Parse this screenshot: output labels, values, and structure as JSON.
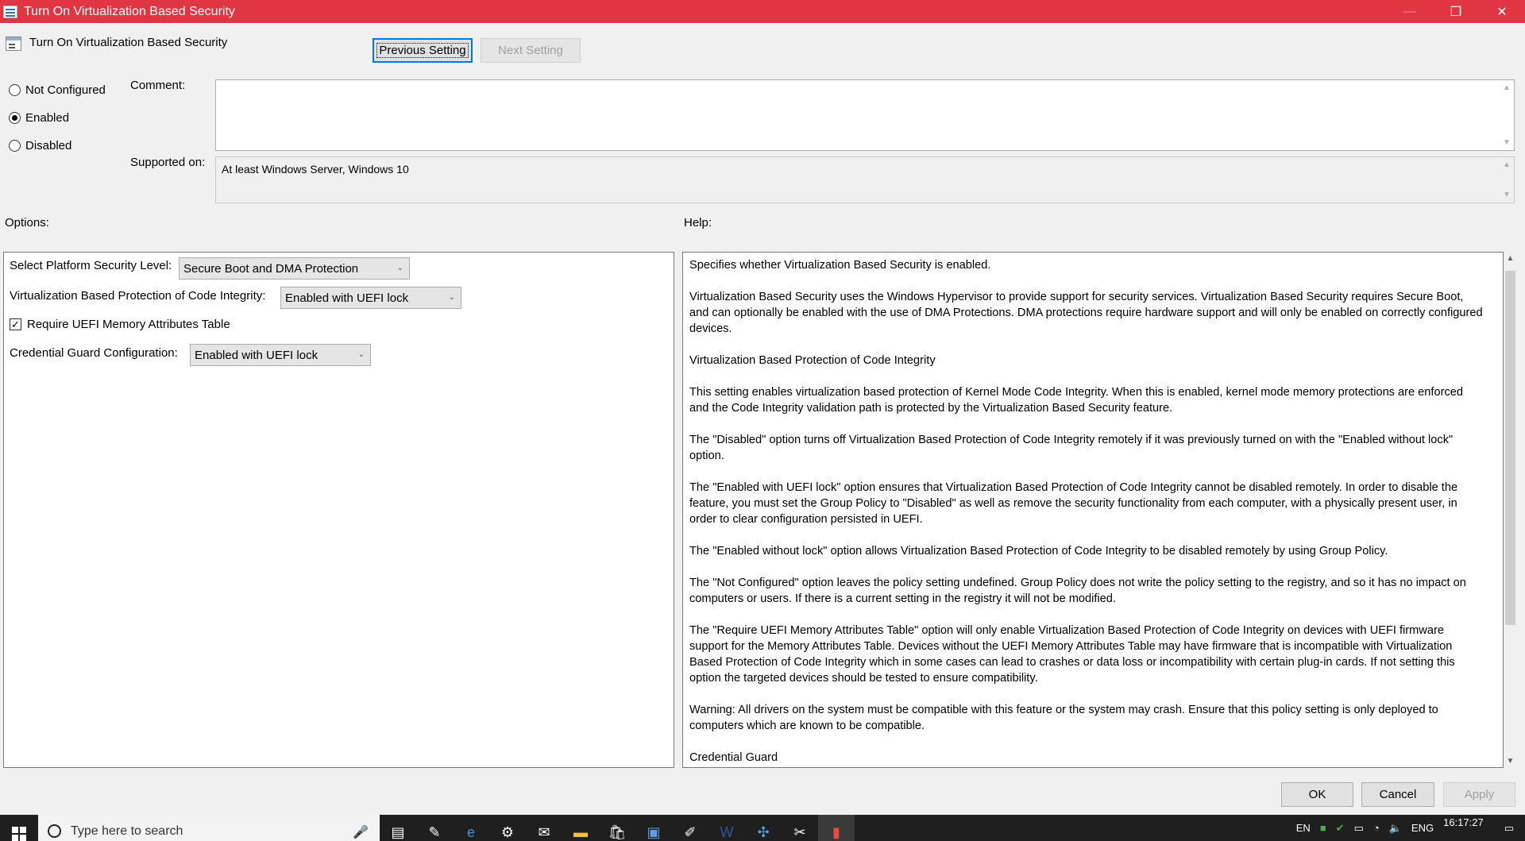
{
  "window": {
    "title": "Turn On Virtualization Based Security",
    "controls": {
      "minimize": "—",
      "restore": "❐",
      "close": "✕"
    }
  },
  "header": {
    "policy_name": "Turn On Virtualization Based Security",
    "prev_button": "Previous Setting",
    "next_button": "Next Setting"
  },
  "state": {
    "options": [
      {
        "label": "Not Configured",
        "selected": false
      },
      {
        "label": "Enabled",
        "selected": true
      },
      {
        "label": "Disabled",
        "selected": false
      }
    ]
  },
  "comment": {
    "label": "Comment:",
    "value": ""
  },
  "supported": {
    "label": "Supported on:",
    "value": "At least Windows Server, Windows 10"
  },
  "options_panel": {
    "heading": "Options:",
    "platform_label": "Select Platform Security Level:",
    "platform_value": "Secure Boot and DMA Protection",
    "vbp_label": "Virtualization Based Protection of Code Integrity:",
    "vbp_value": "Enabled with UEFI lock",
    "uefi_checkbox_label": "Require UEFI Memory Attributes Table",
    "uefi_checked": true,
    "cg_label": "Credential Guard Configuration:",
    "cg_value": "Enabled with UEFI lock"
  },
  "help_panel": {
    "heading": "Help:",
    "paragraphs": [
      "Specifies whether Virtualization Based Security is enabled.",
      "Virtualization Based Security uses the Windows Hypervisor to provide support for security services. Virtualization Based Security requires Secure Boot, and can optionally be enabled with the use of DMA Protections. DMA protections require hardware support and will only be enabled on correctly configured devices.",
      "Virtualization Based Protection of Code Integrity",
      "This setting enables virtualization based protection of Kernel Mode Code Integrity. When this is enabled, kernel mode memory protections are enforced and the Code Integrity validation path is protected by the Virtualization Based Security feature.",
      "The \"Disabled\" option turns off Virtualization Based Protection of Code Integrity remotely if it was previously turned on with the \"Enabled without lock\" option.",
      "The \"Enabled with UEFI lock\" option ensures that Virtualization Based Protection of Code Integrity cannot be disabled remotely. In order to disable the feature, you must set the Group Policy to \"Disabled\" as well as remove the security functionality from each computer, with a physically present user, in order to clear configuration persisted in UEFI.",
      "The \"Enabled without lock\" option allows Virtualization Based Protection of Code Integrity to be disabled remotely by using Group Policy.",
      "The \"Not Configured\" option leaves the policy setting undefined. Group Policy does not write the policy setting to the registry, and so it has no impact on computers or users. If there is a current setting in the registry it will not be modified.",
      "The \"Require UEFI Memory Attributes Table\" option will only enable Virtualization Based Protection of Code Integrity on devices with UEFI firmware support for the Memory Attributes Table. Devices without the UEFI Memory Attributes Table may have firmware that is incompatible with Virtualization Based Protection of Code Integrity which in some cases can lead to crashes or data loss or incompatibility with certain plug-in cards. If not setting this option the targeted devices should be tested to ensure compatibility.",
      "Warning: All drivers on the system must be compatible with this feature or the system may crash. Ensure that this policy setting is only deployed to computers which are known to be compatible.",
      "Credential Guard"
    ]
  },
  "footer": {
    "ok": "OK",
    "cancel": "Cancel",
    "apply": "Apply"
  },
  "taskbar": {
    "search_placeholder": "Type here to search",
    "tray_lang": "EN",
    "tray_input": "ENG",
    "time": "16:17:27"
  }
}
